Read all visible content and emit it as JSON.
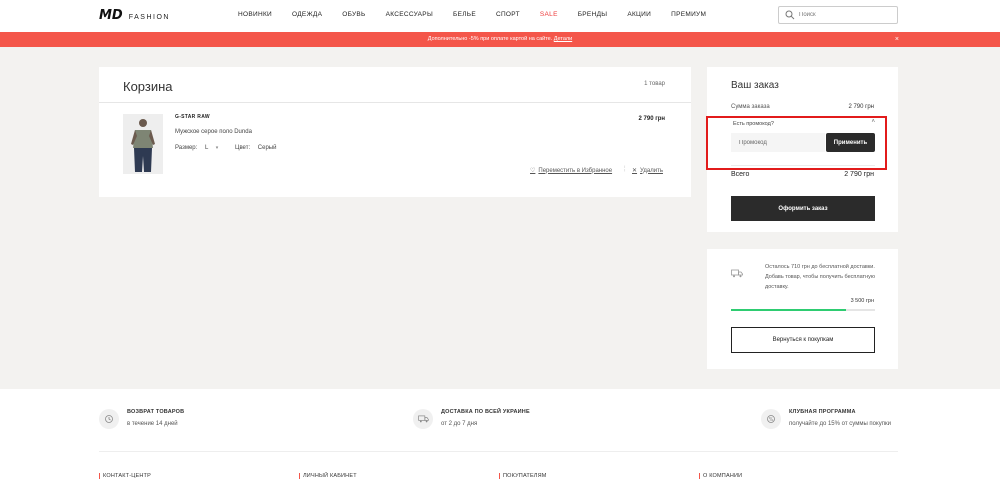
{
  "header": {
    "logo_md": "MD",
    "logo_fashion": "FASHION",
    "nav": [
      {
        "label": "НОВИНКИ",
        "sale": false
      },
      {
        "label": "ОДЕЖДА",
        "sale": false
      },
      {
        "label": "ОБУВЬ",
        "sale": false
      },
      {
        "label": "АКСЕССУАРЫ",
        "sale": false
      },
      {
        "label": "БЕЛЬЕ",
        "sale": false
      },
      {
        "label": "СПОРТ",
        "sale": false
      },
      {
        "label": "SALE",
        "sale": true
      },
      {
        "label": "БРЕНДЫ",
        "sale": false
      },
      {
        "label": "АКЦИИ",
        "sale": false
      },
      {
        "label": "ПРЕМИУМ",
        "sale": false
      }
    ],
    "search_placeholder": "Поиск",
    "search_icon": "search-icon"
  },
  "promo_bar": {
    "text": "Дополнительно -5% при оплате картой на сайте. ",
    "link": "Детали",
    "close": "×",
    "color": "#f4564a"
  },
  "cart": {
    "title": "Корзина",
    "count": "1 товар",
    "item": {
      "brand": "G-STAR RAW",
      "name": "Мужское серое поло Dunda",
      "size_label": "Размер:",
      "size_value": "L",
      "color_label": "Цвет:",
      "color_value": "Серый",
      "price": "2 790 грн",
      "favorite_link": "Переместить в Избранное",
      "remove_link": "Удалить"
    }
  },
  "order": {
    "title": "Ваш заказ",
    "sum_label": "Сумма заказа",
    "sum_value": "2 790 грн",
    "promo_question": "Есть промокод?",
    "promo_placeholder": "Промокод",
    "apply_label": "Применить",
    "total_label": "Всего",
    "total_value": "2 790 грн",
    "checkout_label": "Оформить заказ",
    "highlight_color": "#e21b1b"
  },
  "delivery": {
    "text": "Осталось 710 грн до бесплатной доставки. Добавь товар, чтобы получить бесплатную доставку.",
    "threshold": "3 500 грн",
    "progress_fraction": 0.797,
    "progress_color": "#2ecc71",
    "back_label": "Вернуться к покупкам"
  },
  "footer": {
    "features": [
      {
        "icon": "return-icon",
        "title": "ВОЗВРАТ ТОВАРОВ",
        "sub": "в течение 14 дней"
      },
      {
        "icon": "truck-icon",
        "title": "ДОСТАВКА ПО ВСЕЙ УКРАИНЕ",
        "sub": "от 2 до 7 дня"
      },
      {
        "icon": "club-icon",
        "title": "КЛУБНАЯ ПРОГРАММА",
        "sub": "получайте до 15% от суммы покупки"
      }
    ],
    "columns": [
      "КОНТАКТ-ЦЕНТР",
      "ЛИЧНЫЙ КАБИНЕТ",
      "ПОКУПАТЕЛЯМ",
      "О КОМПАНИИ"
    ]
  }
}
